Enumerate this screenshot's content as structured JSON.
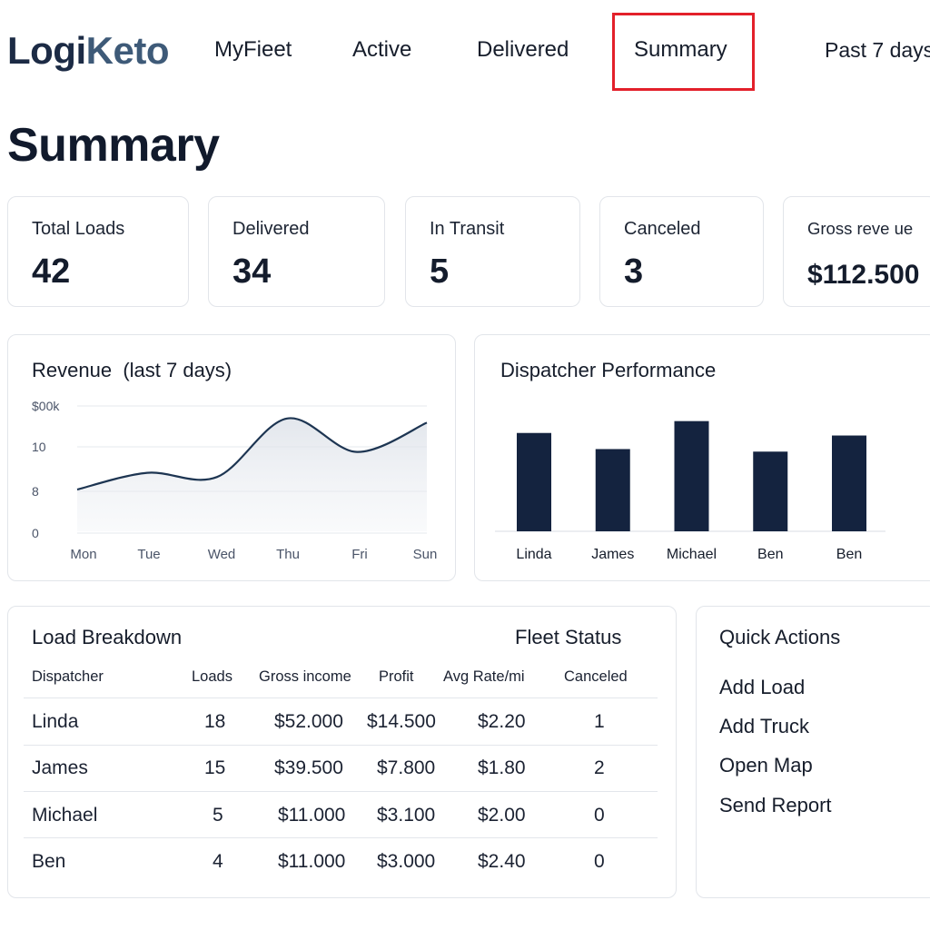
{
  "app": {
    "logo_part1": "Logi",
    "logo_part2": "Keto"
  },
  "nav": {
    "tabs": [
      {
        "label": "MyFieet"
      },
      {
        "label": "Active"
      },
      {
        "label": "Delivered"
      },
      {
        "label": "Summary",
        "selected": true
      }
    ],
    "range_label": "Past 7 days"
  },
  "page_title": "Summary",
  "stats": [
    {
      "label": "Total Loads",
      "value": "42"
    },
    {
      "label": "Delivered",
      "value": "34"
    },
    {
      "label": "In Transit",
      "value": "5"
    },
    {
      "label": "Canceled",
      "value": "3"
    },
    {
      "label": "Gross reve ue",
      "value": "$112.500"
    }
  ],
  "revenue_panel": {
    "title": "Revenue",
    "subtitle": "(last 7 days)"
  },
  "dispatcher_panel": {
    "title": "Dispatcher Performance"
  },
  "chart_data": [
    {
      "type": "area",
      "title": "Revenue (last 7 days)",
      "x_tick_labels": [
        "Mon",
        "Tue",
        "Wed",
        "Thu",
        "Fri",
        "Sun"
      ],
      "y_tick_labels": [
        "$00k",
        "10",
        "8",
        "0"
      ],
      "series": [
        {
          "x": [
            "Mon",
            "Tue",
            "Wed",
            "Thu",
            "Fri",
            "Sun"
          ],
          "values": [
            5,
            7,
            6.5,
            13.5,
            9.5,
            13
          ]
        }
      ],
      "grid": true
    },
    {
      "type": "bar",
      "title": "Dispatcher Performance",
      "categories": [
        "Linda",
        "James",
        "Michael",
        "Ben",
        "Ben"
      ],
      "values": [
        11.6,
        9.7,
        13,
        9.4,
        11.3
      ],
      "ylim": [
        0,
        15
      ],
      "colors": {
        "bar": "#14233f"
      }
    }
  ],
  "load_breakdown": {
    "title": "Load Breakdown",
    "fleet_status_label": "Fleet Status",
    "columns": [
      "Dispatcher",
      "Loads",
      "Gross income",
      "Profit",
      "Avg Rate/mi",
      "Canceled"
    ],
    "rows": [
      [
        "Linda",
        "18",
        "$52.000",
        "$14.500",
        "$2.20",
        "1"
      ],
      [
        "James",
        "15",
        "$39.500",
        "$7.800",
        "$1.80",
        "2"
      ],
      [
        "Michael",
        "5",
        "$11.000",
        "$3.100",
        "$2.00",
        "0"
      ],
      [
        "Ben",
        "4",
        "$11.000",
        "$3.000",
        "$2.40",
        "0"
      ]
    ]
  },
  "quick_actions": {
    "title": "Quick Actions",
    "items": [
      "Add Load",
      "Add Truck",
      "Open Map",
      "Send Report"
    ]
  },
  "colors": {
    "accent_highlight": "#e3202a",
    "bar": "#14233f",
    "line": "#1d3552",
    "text": "#161d2b"
  }
}
